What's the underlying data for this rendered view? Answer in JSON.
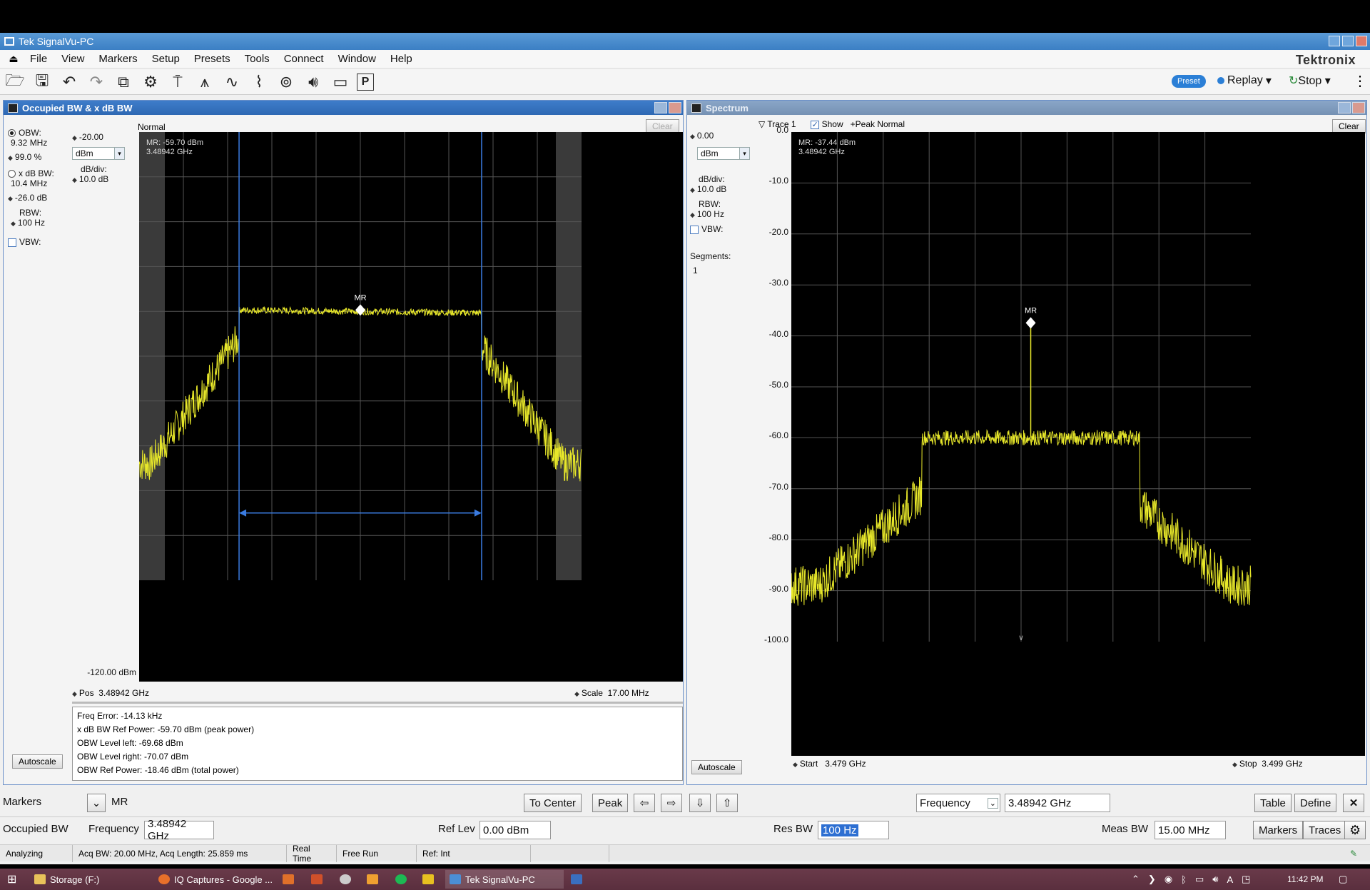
{
  "window": {
    "title": "Tek SignalVu-PC",
    "brand": "Tektronix"
  },
  "menu": [
    "File",
    "View",
    "Markers",
    "Setup",
    "Presets",
    "Tools",
    "Connect",
    "Window",
    "Help"
  ],
  "toolbar": {
    "icons": [
      "open-icon",
      "save-icon",
      "undo-icon",
      "redo-icon",
      "copy-icon",
      "settings-gear-icon",
      "trigger-icon",
      "spectrum-icon",
      "time-overview-icon",
      "waveform-icon",
      "acquire-icon",
      "audio-icon",
      "camera-icon",
      "p-icon"
    ],
    "preset_label": "Preset",
    "replay_label": "Replay",
    "stop_label": "Stop"
  },
  "left_panel": {
    "title": "Occupied BW & x dB BW",
    "mode_label": "Normal",
    "clear_label": "Clear",
    "obw_label": "OBW:",
    "obw_value": "9.32 MHz",
    "obw_percent": "99.0 %",
    "xdb_label": "x dB BW:",
    "xdb_value": "10.4 MHz",
    "xdb_level": "-26.0 dB",
    "rbw_label": "RBW:",
    "rbw_value": "100 Hz",
    "vbw_label": "VBW:",
    "ref_level": "-20.00",
    "unit": "dBm",
    "dbdiv_label": "dB/div:",
    "dbdiv_value": "10.0 dB",
    "bottom_level": "-120.00 dBm",
    "marker_readout_line1": "MR: -59.70 dBm",
    "marker_readout_line2": "3.48942 GHz",
    "marker_label": "MR",
    "pos_label": "Pos",
    "pos_value": "3.48942 GHz",
    "scale_label": "Scale",
    "scale_value": "17.00 MHz",
    "autoscale_label": "Autoscale",
    "results": [
      "Freq Error: -14.13 kHz",
      "x dB BW Ref Power: -59.70 dBm (peak power)",
      "OBW Level left: -69.68 dBm",
      "OBW Level right: -70.07 dBm",
      "OBW Ref Power: -18.46 dBm (total power)"
    ]
  },
  "right_panel": {
    "title": "Spectrum",
    "trace_label": "Trace 1",
    "show_label": "Show",
    "detector_label": "+Peak Normal",
    "clear_label": "Clear",
    "ref_level": "0.00",
    "unit": "dBm",
    "dbdiv_label": "dB/div:",
    "dbdiv_value": "10.0 dB",
    "rbw_label": "RBW:",
    "rbw_value": "100 Hz",
    "vbw_label": "VBW:",
    "segments_label": "Segments:",
    "segments_value": "1",
    "y_ticks": [
      "0.0",
      "-10.0",
      "-20.0",
      "-30.0",
      "-40.0",
      "-50.0",
      "-60.0",
      "-70.0",
      "-80.0",
      "-90.0",
      "-100.0"
    ],
    "marker_readout_line1": "MR: -37.44 dBm",
    "marker_readout_line2": "3.48942 GHz",
    "marker_label": "MR",
    "start_label": "Start",
    "start_value": "3.479 GHz",
    "stop_label": "Stop",
    "stop_value": "3.499 GHz",
    "autoscale_label": "Autoscale"
  },
  "markers_bar": {
    "label": "Markers",
    "selected": "MR",
    "to_center": "To Center",
    "peak": "Peak",
    "freq_select": "Frequency",
    "freq_value": "3.48942 GHz",
    "table": "Table",
    "define": "Define"
  },
  "settings_bar": {
    "measurement": "Occupied BW",
    "freq_label": "Frequency",
    "freq_value": "3.48942 GHz",
    "reflev_label": "Ref Lev",
    "reflev_value": "0.00 dBm",
    "resbw_label": "Res BW",
    "resbw_value": "100 Hz",
    "measbw_label": "Meas BW",
    "measbw_value": "15.00 MHz",
    "markers_btn": "Markers",
    "traces_btn": "Traces"
  },
  "status": {
    "state": "Analyzing",
    "acq": "Acq BW: 20.00 MHz, Acq Length: 25.859 ms",
    "mode": "Real Time",
    "trigger": "Free Run",
    "ref": "Ref: Int"
  },
  "taskbar": {
    "items": [
      "Storage (F:)",
      "IQ Captures - Google ...",
      "Tek SignalVu-PC"
    ],
    "time": "11:42 PM"
  },
  "chart_data": [
    {
      "type": "line",
      "title": "Occupied BW & x dB BW",
      "xlabel": "",
      "ylabel": "",
      "x_center_ghz": 3.48942,
      "x_span_mhz": 17.0,
      "ylim": [
        -120,
        -20
      ],
      "series": [
        {
          "values_dbm": [
            -93,
            -91,
            -88,
            -80,
            -60,
            -59.7,
            -60,
            -60,
            -80,
            -89,
            -92
          ]
        }
      ],
      "obw_edges_mhz": [
        -4.66,
        4.66
      ]
    },
    {
      "type": "line",
      "title": "Spectrum",
      "xlabel": "",
      "ylabel": "",
      "x_start_ghz": 3.479,
      "x_stop_ghz": 3.499,
      "ylim": [
        -100,
        0
      ],
      "series": [
        {
          "values_dbm": [
            -90,
            -88,
            -84,
            -78,
            -61,
            -60,
            -37.44,
            -60,
            -61,
            -80,
            -87,
            -89
          ]
        }
      ]
    }
  ]
}
